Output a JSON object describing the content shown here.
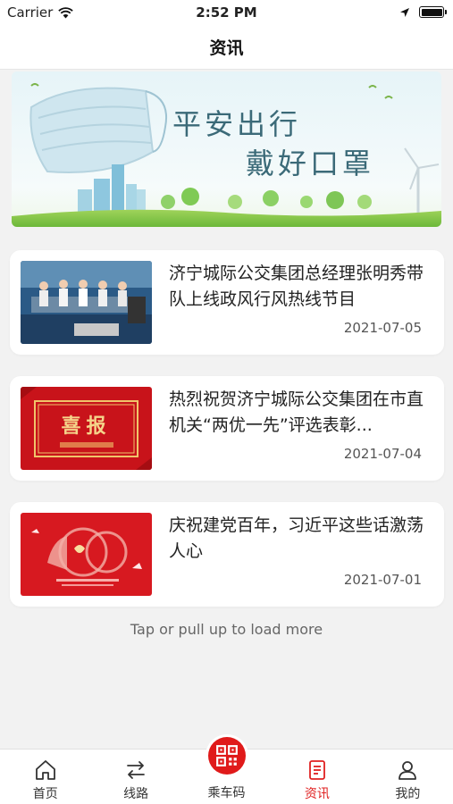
{
  "status_bar": {
    "carrier": "Carrier",
    "time": "2:52 PM"
  },
  "header": {
    "title": "资讯"
  },
  "banner": {
    "line1": "平安出行",
    "line2": "戴好口罩"
  },
  "news": [
    {
      "title": "济宁城际公交集团总经理张明秀带队上线政风行风热线节目",
      "date": "2021-07-05",
      "thumb": "studio-photo"
    },
    {
      "title": "热烈祝贺济宁城际公交集团在市直机关“两优一先”评选表彰...",
      "date": "2021-07-04",
      "thumb": "xibao-poster",
      "thumb_text": "喜报"
    },
    {
      "title": "庆祝建党百年，习近平这些话激荡人心",
      "date": "2021-07-01",
      "thumb": "party-100-poster"
    }
  ],
  "load_more": "Tap or pull up to load more",
  "tabs": [
    {
      "label": "首页",
      "icon": "home-icon"
    },
    {
      "label": "线路",
      "icon": "route-icon"
    },
    {
      "label": "乘车码",
      "icon": "qr-code-icon"
    },
    {
      "label": "资讯",
      "icon": "news-icon",
      "active": true
    },
    {
      "label": "我的",
      "icon": "user-icon"
    }
  ],
  "colors": {
    "accent": "#e02020",
    "background": "#f2f2f2",
    "banner_text": "#3b6a78"
  }
}
